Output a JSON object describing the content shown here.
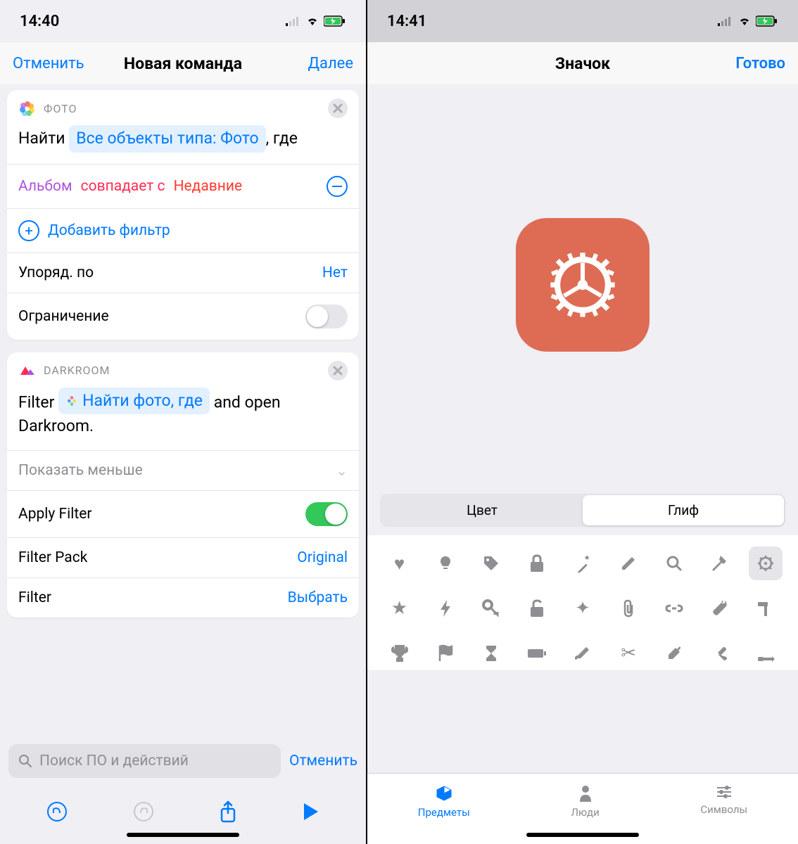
{
  "left": {
    "status_time": "14:40",
    "nav": {
      "cancel": "Отменить",
      "title": "Новая команда",
      "next": "Далее"
    },
    "card1": {
      "app": "ФОТО",
      "find": "Найти",
      "token": "Все объекты типа: Фото",
      "where": ", где",
      "filter": {
        "album": "Альбом",
        "matches": "совпадает с",
        "recent": "Недавние"
      },
      "add_filter": "Добавить фильтр",
      "sort": {
        "label": "Упоряд. по",
        "value": "Нет"
      },
      "limit": "Ограничение"
    },
    "card2": {
      "app": "DARKROOM",
      "filter_word": "Filter",
      "token": "Найти фото, где",
      "rest": "and open Darkroom.",
      "show_less": "Показать меньше",
      "apply": "Apply Filter",
      "pack": {
        "label": "Filter Pack",
        "value": "Original"
      },
      "filt": {
        "label": "Filter",
        "value": "Выбрать"
      }
    },
    "search": {
      "placeholder": "Поиск ПО и действий",
      "cancel": "Отменить"
    }
  },
  "right": {
    "status_time": "14:41",
    "nav": {
      "title": "Значок",
      "done": "Готово"
    },
    "segmented": {
      "color": "Цвет",
      "glyph": "Глиф"
    },
    "tabs": {
      "objects": "Предметы",
      "people": "Люди",
      "symbols": "Символы"
    },
    "glyphs": [
      "heart",
      "bulb",
      "tag",
      "lock",
      "wand",
      "pencil",
      "search",
      "hammer",
      "gear",
      "star",
      "bolt",
      "key",
      "unlock",
      "sparkle",
      "paperclip",
      "link",
      "wrench",
      "hammer2",
      "trophy",
      "flag",
      "hourglass",
      "battery",
      "paint",
      "scissors",
      "dropper",
      "tools",
      "screwdriver"
    ]
  }
}
